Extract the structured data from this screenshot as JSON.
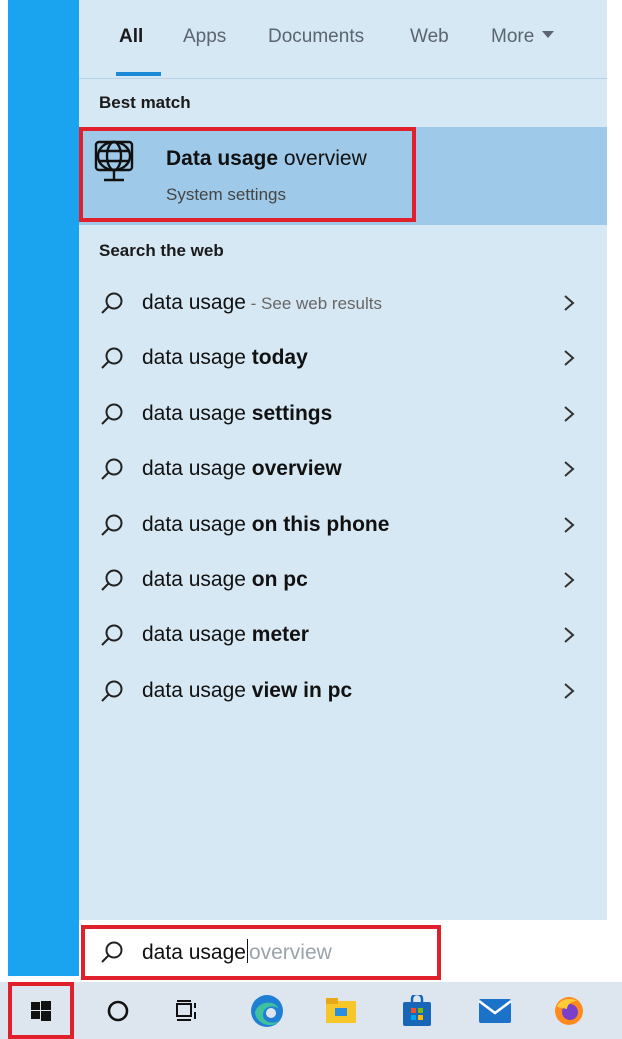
{
  "tabs": {
    "items": [
      {
        "label": "All",
        "active": true
      },
      {
        "label": "Apps",
        "active": false
      },
      {
        "label": "Documents",
        "active": false
      },
      {
        "label": "Web",
        "active": false
      },
      {
        "label": "More",
        "active": false
      }
    ]
  },
  "best_match": {
    "heading": "Best match",
    "title_bold": "Data usage",
    "title_rest": " overview",
    "subtitle": "System settings",
    "icon": "globe-monitor-icon"
  },
  "web": {
    "heading": "Search the web",
    "results": [
      {
        "plain": "data usage",
        "bold": "",
        "hint": " - See web results"
      },
      {
        "plain": "data usage ",
        "bold": "today",
        "hint": ""
      },
      {
        "plain": "data usage ",
        "bold": "settings",
        "hint": ""
      },
      {
        "plain": "data usage ",
        "bold": "overview",
        "hint": ""
      },
      {
        "plain": "data usage ",
        "bold": "on this phone",
        "hint": ""
      },
      {
        "plain": "data usage ",
        "bold": "on pc",
        "hint": ""
      },
      {
        "plain": "data usage ",
        "bold": "meter",
        "hint": ""
      },
      {
        "plain": "data usage ",
        "bold": "view in pc",
        "hint": ""
      }
    ]
  },
  "search": {
    "typed": "data usage",
    "suggestion": "overview"
  },
  "taskbar": {
    "items": [
      "start-icon",
      "cortana-icon",
      "task-view-icon",
      "edge-icon",
      "file-explorer-icon",
      "store-icon",
      "mail-icon",
      "firefox-icon"
    ]
  },
  "colors": {
    "panel": "#d6e8f4",
    "highlight": "#9ec9e8",
    "accent": "#1b8ad6",
    "annotation_red": "#e0202b",
    "desktop_blue": "#1aa3ef"
  }
}
